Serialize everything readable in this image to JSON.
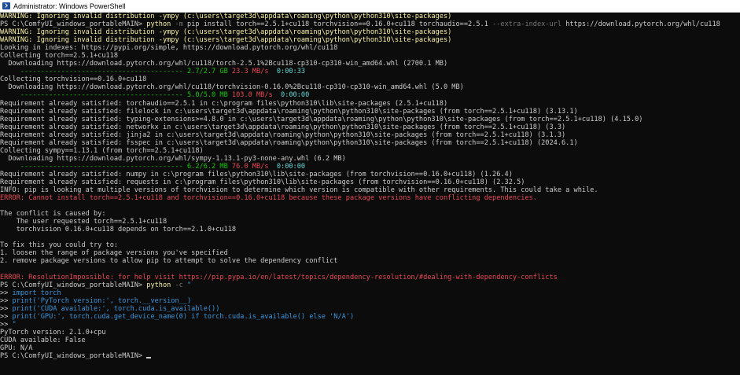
{
  "window": {
    "title": "Administrator: Windows PowerShell"
  },
  "lines": [
    {
      "segs": [
        {
          "t": "WARNING: Ignoring invalid distribution -ympy (c:\\users\\target3d\\appdata\\roaming\\python\\python310\\site-packages)",
          "c": "warn"
        }
      ]
    },
    {
      "segs": [
        {
          "t": "PS C:\\ComfyUI_windows_portableMAIN> ",
          "c": "prompt"
        },
        {
          "t": "python",
          "c": "cmd"
        },
        {
          "t": " -m",
          "c": "param"
        },
        {
          "t": " pip install torch==2.5.1+cu118 torchvision==0.16.0+cu118 torchaudio==2.5.1",
          "c": "arg"
        },
        {
          "t": " --extra-index-url",
          "c": "param"
        },
        {
          "t": " https://download.pytorch.org/whl/cu118",
          "c": "arg"
        }
      ]
    },
    {
      "segs": [
        {
          "t": "WARNING: Ignoring invalid distribution -ympy (c:\\users\\target3d\\appdata\\roaming\\python\\python310\\site-packages)",
          "c": "warn"
        }
      ]
    },
    {
      "segs": [
        {
          "t": "WARNING: Ignoring invalid distribution -ympy (c:\\users\\target3d\\appdata\\roaming\\python\\python310\\site-packages)",
          "c": "warn"
        }
      ]
    },
    {
      "segs": [
        {
          "t": "Looking in indexes: https://pypi.org/simple, https://download.pytorch.org/whl/cu118",
          "c": "dim"
        }
      ]
    },
    {
      "segs": [
        {
          "t": "Collecting torch==2.5.1+cu118",
          "c": "dim"
        }
      ]
    },
    {
      "segs": [
        {
          "t": "  Downloading https://download.pytorch.org/whl/cu118/torch-2.5.1%2Bcu118-cp310-cp310-win_amd64.whl (2700.1 MB)",
          "c": "dim"
        }
      ]
    },
    {
      "segs": [
        {
          "t": "     ---------------------------------------- ",
          "c": "bar"
        },
        {
          "t": "2.7/2.7 GB",
          "c": "prog"
        },
        {
          "t": " 23.3 MB/s",
          "c": "speed"
        },
        {
          "t": "  0:00:33",
          "c": "eta"
        }
      ]
    },
    {
      "segs": [
        {
          "t": "Collecting torchvision==0.16.0+cu118",
          "c": "dim"
        }
      ]
    },
    {
      "segs": [
        {
          "t": "  Downloading https://download.pytorch.org/whl/cu118/torchvision-0.16.0%2Bcu118-cp310-cp310-win_amd64.whl (5.0 MB)",
          "c": "dim"
        }
      ]
    },
    {
      "segs": [
        {
          "t": "     ---------------------------------------- ",
          "c": "bar"
        },
        {
          "t": "5.0/5.0 MB",
          "c": "prog"
        },
        {
          "t": " 103.0 MB/s",
          "c": "speed"
        },
        {
          "t": "  0:00:00",
          "c": "eta"
        }
      ]
    },
    {
      "segs": [
        {
          "t": "Requirement already satisfied: torchaudio==2.5.1 in c:\\program files\\python310\\lib\\site-packages (2.5.1+cu118)",
          "c": "dim"
        }
      ]
    },
    {
      "segs": [
        {
          "t": "Requirement already satisfied: filelock in c:\\users\\target3d\\appdata\\roaming\\python\\python310\\site-packages (from torch==2.5.1+cu118) (3.13.1)",
          "c": "dim"
        }
      ]
    },
    {
      "segs": [
        {
          "t": "Requirement already satisfied: typing-extensions>=4.8.0 in c:\\users\\target3d\\appdata\\roaming\\python\\python310\\site-packages (from torch==2.5.1+cu118) (4.15.0)",
          "c": "dim"
        }
      ]
    },
    {
      "segs": [
        {
          "t": "Requirement already satisfied: networkx in c:\\users\\target3d\\appdata\\roaming\\python\\python310\\site-packages (from torch==2.5.1+cu118) (3.3)",
          "c": "dim"
        }
      ]
    },
    {
      "segs": [
        {
          "t": "Requirement already satisfied: jinja2 in c:\\users\\target3d\\appdata\\roaming\\python\\python310\\site-packages (from torch==2.5.1+cu118) (3.1.3)",
          "c": "dim"
        }
      ]
    },
    {
      "segs": [
        {
          "t": "Requirement already satisfied: fsspec in c:\\users\\target3d\\appdata\\roaming\\python\\python310\\site-packages (from torch==2.5.1+cu118) (2024.6.1)",
          "c": "dim"
        }
      ]
    },
    {
      "segs": [
        {
          "t": "Collecting sympy==1.13.1 (from torch==2.5.1+cu118)",
          "c": "dim"
        }
      ]
    },
    {
      "segs": [
        {
          "t": "  Downloading https://download.pytorch.org/whl/sympy-1.13.1-py3-none-any.whl (6.2 MB)",
          "c": "dim"
        }
      ]
    },
    {
      "segs": [
        {
          "t": "     ---------------------------------------- ",
          "c": "bar"
        },
        {
          "t": "6.2/6.2 MB",
          "c": "prog"
        },
        {
          "t": " 76.0 MB/s",
          "c": "speed"
        },
        {
          "t": "  0:00:00",
          "c": "eta"
        }
      ]
    },
    {
      "segs": [
        {
          "t": "Requirement already satisfied: numpy in c:\\program files\\python310\\lib\\site-packages (from torchvision==0.16.0+cu118) (1.26.4)",
          "c": "dim"
        }
      ]
    },
    {
      "segs": [
        {
          "t": "Requirement already satisfied: requests in c:\\program files\\python310\\lib\\site-packages (from torchvision==0.16.0+cu118) (2.32.5)",
          "c": "dim"
        }
      ]
    },
    {
      "segs": [
        {
          "t": "INFO: pip is looking at multiple versions of torchvision to determine which version is compatible with other requirements. This could take a while.",
          "c": "dim"
        }
      ]
    },
    {
      "segs": [
        {
          "t": "ERROR: Cannot install torch==2.5.1+cu118 and torchvision==0.16.0+cu118 because these package versions have conflicting dependencies.",
          "c": "err"
        }
      ]
    },
    {
      "segs": [
        {
          "t": "",
          "c": "dim"
        }
      ]
    },
    {
      "segs": [
        {
          "t": "The conflict is caused by:",
          "c": "dim"
        }
      ]
    },
    {
      "segs": [
        {
          "t": "    The user requested torch==2.5.1+cu118",
          "c": "dim"
        }
      ]
    },
    {
      "segs": [
        {
          "t": "    torchvision 0.16.0+cu118 depends on torch==2.1.0+cu118",
          "c": "dim"
        }
      ]
    },
    {
      "segs": [
        {
          "t": "",
          "c": "dim"
        }
      ]
    },
    {
      "segs": [
        {
          "t": "To fix this you could try to:",
          "c": "dim"
        }
      ]
    },
    {
      "segs": [
        {
          "t": "1. loosen the range of package versions you've specified",
          "c": "dim"
        }
      ]
    },
    {
      "segs": [
        {
          "t": "2. remove package versions to allow pip to attempt to solve the dependency conflict",
          "c": "dim"
        }
      ]
    },
    {
      "segs": [
        {
          "t": "",
          "c": "dim"
        }
      ]
    },
    {
      "segs": [
        {
          "t": "ERROR: ResolutionImpossible: for help visit https://pip.pypa.io/en/latest/topics/dependency-resolution/#dealing-with-dependency-conflicts",
          "c": "err"
        }
      ]
    },
    {
      "segs": [
        {
          "t": "PS C:\\ComfyUI_windows_portableMAIN> ",
          "c": "prompt"
        },
        {
          "t": "python",
          "c": "cmd"
        },
        {
          "t": " -c",
          "c": "param"
        },
        {
          "t": " \"",
          "c": "str"
        }
      ]
    },
    {
      "segs": [
        {
          "t": ">> ",
          "c": "prompt"
        },
        {
          "t": "import torch",
          "c": "str"
        }
      ]
    },
    {
      "segs": [
        {
          "t": ">> ",
          "c": "prompt"
        },
        {
          "t": "print('PyTorch version:', torch.__version__)",
          "c": "str"
        }
      ]
    },
    {
      "segs": [
        {
          "t": ">> ",
          "c": "prompt"
        },
        {
          "t": "print('CUDA available:', torch.cuda.is_available())",
          "c": "str"
        }
      ]
    },
    {
      "segs": [
        {
          "t": ">> ",
          "c": "prompt"
        },
        {
          "t": "print('GPU:', torch.cuda.get_device_name(0) if torch.cuda.is_available() else 'N/A')",
          "c": "str"
        }
      ]
    },
    {
      "segs": [
        {
          "t": ">> ",
          "c": "prompt"
        },
        {
          "t": "\"",
          "c": "str"
        }
      ]
    },
    {
      "segs": [
        {
          "t": "PyTorch version: 2.1.0+cpu",
          "c": "dim"
        }
      ]
    },
    {
      "segs": [
        {
          "t": "CUDA available: False",
          "c": "dim"
        }
      ]
    },
    {
      "segs": [
        {
          "t": "GPU: N/A",
          "c": "dim"
        }
      ]
    },
    {
      "segs": [
        {
          "t": "PS C:\\ComfyUI_windows_portableMAIN> ",
          "c": "prompt"
        }
      ],
      "cursor": true
    }
  ]
}
